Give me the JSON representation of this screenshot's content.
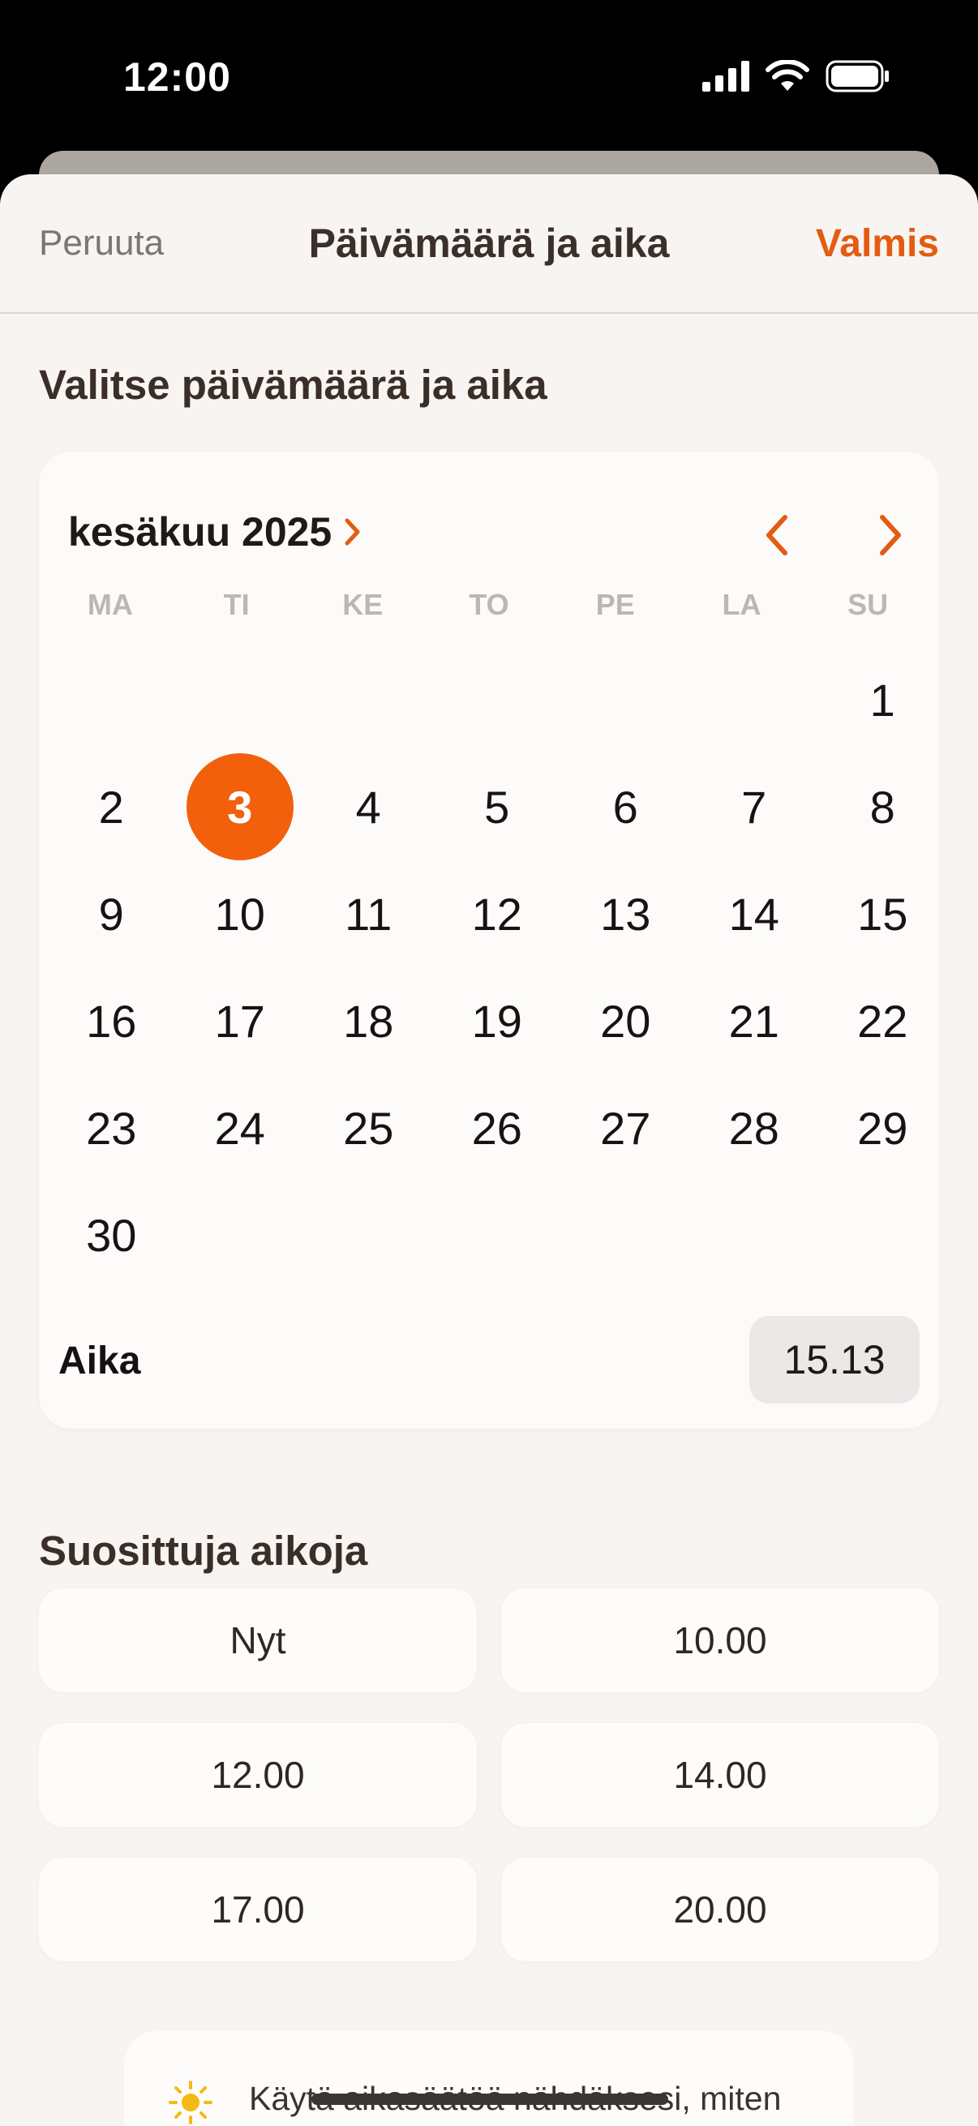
{
  "status_bar": {
    "time": "12:00"
  },
  "nav": {
    "cancel": "Peruuta",
    "title": "Päivämäärä ja aika",
    "done": "Valmis"
  },
  "colors": {
    "accent": "#f2600c",
    "sheet_bg": "#f7f4f1",
    "card_bg": "#fcfbfa"
  },
  "picker": {
    "section_title": "Valitse päivämäärä ja aika",
    "month_label": "kesäkuu 2025",
    "weekdays": [
      "MA",
      "TI",
      "KE",
      "TO",
      "PE",
      "LA",
      "SU"
    ],
    "leading_blanks": 6,
    "days": [
      "1",
      "2",
      "3",
      "4",
      "5",
      "6",
      "7",
      "8",
      "9",
      "10",
      "11",
      "12",
      "13",
      "14",
      "15",
      "16",
      "17",
      "18",
      "19",
      "20",
      "21",
      "22",
      "23",
      "24",
      "25",
      "26",
      "27",
      "28",
      "29",
      "30"
    ],
    "selected_day": "3",
    "time_label": "Aika",
    "time_value": "15.13"
  },
  "suggested": {
    "title": "Suosittuja aikoja",
    "options": [
      "Nyt",
      "10.00",
      "12.00",
      "14.00",
      "17.00",
      "20.00"
    ]
  },
  "tip": {
    "icon": "sun-icon",
    "text": "Käytä aikasäätöä nähdäksesi, miten auringonvalo liikkuu päivän aikana."
  }
}
